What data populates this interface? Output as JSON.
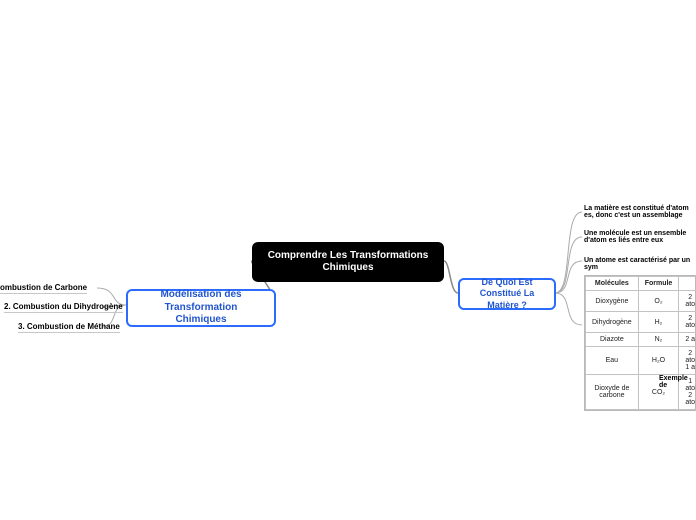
{
  "root": {
    "title": "Comprendre Les Transformations Chimiques"
  },
  "left": {
    "main": "Modélisation des Transformation Chimiques",
    "children": [
      "ombustion de Carbone",
      "2. Combustion du Dihydrogène",
      "3. Combustion de Méthane"
    ]
  },
  "right": {
    "main": "De Quoi Est Constitué La Matière ?",
    "facts": [
      "La matière est constitué d'atom es, donc c'est un assemblage",
      "Une molécule est un ensemble d'atom es liés entre eux",
      "Un atome est caractérisé par un sym"
    ],
    "table": {
      "headers": [
        "Molécules",
        "Formule",
        ""
      ],
      "rows": [
        [
          "Dioxygène",
          "O₂",
          "2 ato"
        ],
        [
          "Dihydrogène",
          "H₂",
          "2 ato"
        ],
        [
          "Diazote",
          "N₂",
          "2 a"
        ],
        [
          "Eau",
          "H₂O",
          "2 ato\n1 a"
        ],
        [
          "Dioxyde de carbone",
          "CO₂",
          "1 ato\n2 ato"
        ]
      ],
      "caption": "Exemple de"
    }
  }
}
